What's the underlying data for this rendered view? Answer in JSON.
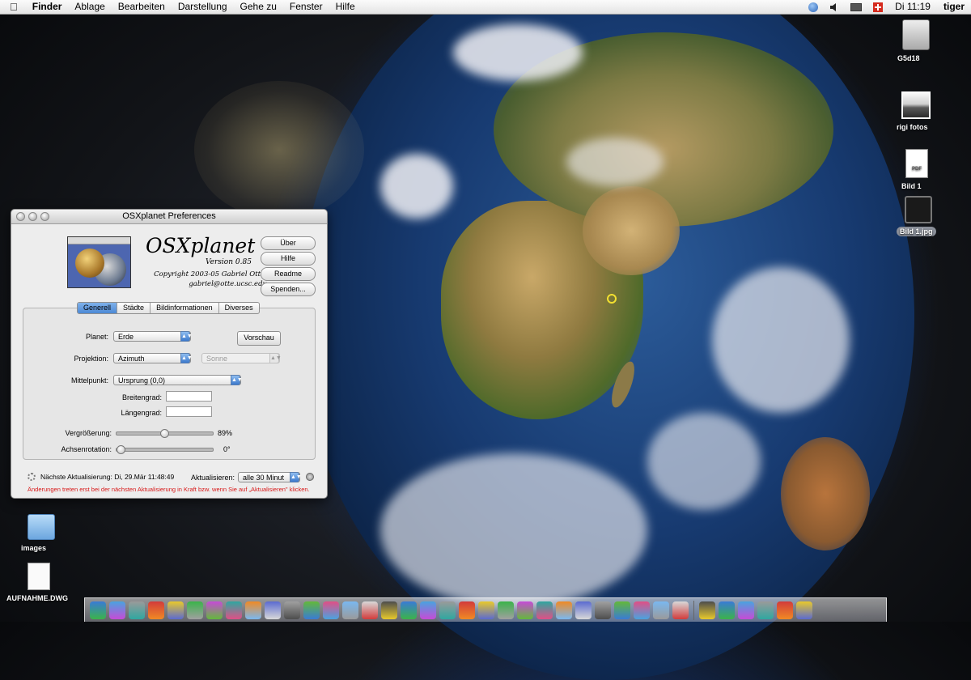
{
  "menubar": {
    "app": "Finder",
    "menus": [
      "Ablage",
      "Bearbeiten",
      "Darstellung",
      "Gehe zu",
      "Fenster",
      "Hilfe"
    ],
    "clock": "Di 11:19",
    "user": "tiger"
  },
  "desktop": {
    "icons": [
      {
        "label": "G5d18"
      },
      {
        "label": "rigi fotos"
      },
      {
        "label": "Bild 1"
      },
      {
        "label": "Bild 1.jpg"
      },
      {
        "label": "images"
      },
      {
        "label": "AUFNAHME.DWG"
      }
    ],
    "pdf_badge": "PDF"
  },
  "window": {
    "title": "OSXplanet Preferences",
    "app_name": "OSXplanet",
    "version": "Version 0.85",
    "copyright_line1": "Copyright 2003-05 Gabriel Otte-",
    "copyright_line2": "gabriel@otte.ucsc.edu",
    "buttons": {
      "about": "Über",
      "help": "Hilfe",
      "readme": "Readme",
      "donate": "Spenden..."
    },
    "tabs": [
      "Generell",
      "Städte",
      "Bildinformationen",
      "Diverses"
    ],
    "active_tab": "Generell",
    "planet_label": "Planet:",
    "planet_value": "Erde",
    "preview_button": "Vorschau",
    "projection_label": "Projektion:",
    "projection_value": "Azimuth",
    "sun_value": "Sonne",
    "center_label": "Mittelpunkt:",
    "center_value": "Ursprung (0,0)",
    "latitude_label": "Breitengrad:",
    "longitude_label": "Längengrad:",
    "zoom_label": "Vergrößerung:",
    "zoom_value": "89%",
    "zoom_level": 0.89,
    "rotation_label": "Achsenrotation:",
    "rotation_value": "0°",
    "rotation_level": 0.0,
    "next_update": "Nächste Aktualisierung: Di, 29.Mär 11:48:49",
    "update_label": "Aktualisieren:",
    "update_value": "alle 30 Minut",
    "notice": "Änderungen treten erst bei der nächsten Aktualisierung in Kraft bzw. wenn Sie auf „Aktualisieren\" klicken."
  },
  "colors": {
    "accent": "#4c89d6",
    "warning": "#d81818"
  }
}
